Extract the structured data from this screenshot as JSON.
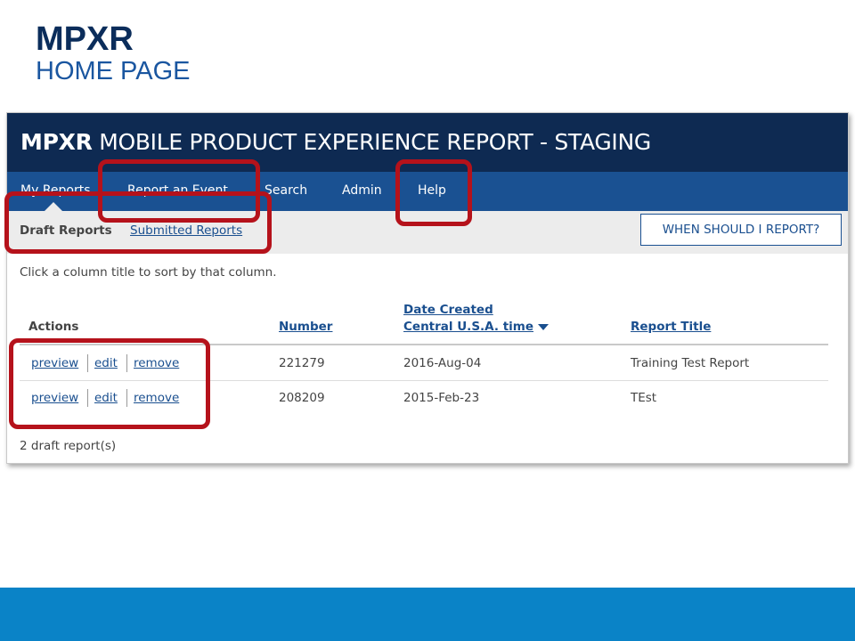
{
  "slide": {
    "title": "MPXR",
    "subtitle": "HOME PAGE"
  },
  "app": {
    "brand": "MPXR",
    "title_rest": "MOBILE PRODUCT EXPERIENCE REPORT - STAGING",
    "nav": [
      "My Reports",
      "Report an Event",
      "Search",
      "Admin",
      "Help"
    ],
    "active_nav": "My Reports",
    "subnav": {
      "active": "Draft Reports",
      "link": "Submitted Reports"
    },
    "help_button": "WHEN SHOULD I REPORT?",
    "hint": "Click a column title to sort by that column.",
    "table": {
      "headers": {
        "actions": "Actions",
        "number": "Number",
        "date_line1": "Date Created",
        "date_line2": "Central U.S.A. time",
        "title": "Report Title"
      },
      "sorted_column": "date",
      "sort_direction": "descending",
      "action_labels": [
        "preview",
        "edit",
        "remove"
      ],
      "rows": [
        {
          "number": "221279",
          "date": "2016-Aug-04",
          "title": "Training Test Report"
        },
        {
          "number": "208209",
          "date": "2015-Feb-23",
          "title": "TEst"
        }
      ]
    },
    "count": "2 draft report(s)"
  },
  "colors": {
    "header_bg": "#0e2a52",
    "nav_bg": "#1a5192",
    "callout": "#b5121b",
    "footer": "#0a83c7",
    "link": "#1a4f8f"
  }
}
